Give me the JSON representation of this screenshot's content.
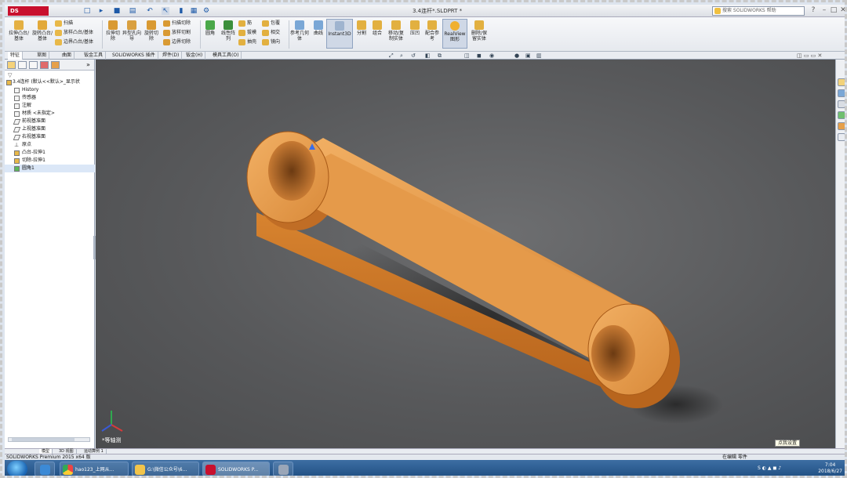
{
  "titlebar": {
    "app_logo": "DS SOLIDWORKS",
    "document_title": "3.4连杆*.SLDPRT *",
    "search_placeholder": "搜索 SOLIDWORKS 帮助",
    "window_controls": [
      "minimize",
      "maximize",
      "close"
    ]
  },
  "ribbon": {
    "large_buttons": [
      {
        "id": "extrude-boss",
        "label": "拉伸凸台/基体",
        "icon": "extrude-boss-icon"
      },
      {
        "id": "revolve-boss",
        "label": "旋转凸台/基体",
        "icon": "revolve-boss-icon"
      },
      {
        "id": "extrude-cut",
        "label": "拉伸切除",
        "icon": "extrude-cut-icon"
      },
      {
        "id": "hole-wizard",
        "label": "异型孔向导",
        "icon": "hole-wizard-icon"
      },
      {
        "id": "revolve-cut",
        "label": "旋转切除",
        "icon": "revolve-cut-icon"
      },
      {
        "id": "fillet",
        "label": "圆角",
        "icon": "fillet-icon"
      },
      {
        "id": "linear-pattern",
        "label": "线性阵列",
        "icon": "linear-pattern-icon"
      },
      {
        "id": "reference-geometry",
        "label": "参考几何体",
        "icon": "reference-geometry-icon"
      },
      {
        "id": "curves",
        "label": "曲线",
        "icon": "curves-icon"
      },
      {
        "id": "instant3d",
        "label": "Instant3D",
        "icon": "instant3d-icon"
      },
      {
        "id": "split",
        "label": "分割",
        "icon": "split-icon"
      },
      {
        "id": "combine",
        "label": "组合",
        "icon": "combine-icon"
      },
      {
        "id": "move-copy",
        "label": "移动/复制实体",
        "icon": "move-copy-icon"
      },
      {
        "id": "indent",
        "label": "压凹",
        "icon": "indent-icon"
      },
      {
        "id": "ref-geom2",
        "label": "配合参考",
        "icon": "mate-reference-icon"
      },
      {
        "id": "realview",
        "label": "RealView图形",
        "icon": "realview-icon"
      },
      {
        "id": "delete-body",
        "label": "删除/保留实体",
        "icon": "delete-body-icon"
      }
    ],
    "small_buttons_group1": [
      "扫描",
      "放样凸台/基体",
      "边界凸台/基体"
    ],
    "small_buttons_group2": [
      "扫描切除",
      "放样切割",
      "边界切除"
    ],
    "small_buttons_group3": [
      "筋",
      "拔模",
      "抽壳"
    ],
    "small_buttons_group4": [
      "包覆",
      "相交",
      "镜向"
    ]
  },
  "command_tabs": [
    "特征",
    "草图",
    "曲面",
    "钣金工具",
    "SOLIDWORKS 插件",
    "焊件(D)",
    "钣金(H)",
    "模具工具(O)"
  ],
  "feature_tree": {
    "filter_icon": "filter-icon",
    "root": "3.4连杆 (默认<<默认>_显示状",
    "items": [
      {
        "label": "History",
        "icon": "history-icon"
      },
      {
        "label": "传感器",
        "icon": "sensor-icon"
      },
      {
        "label": "注解",
        "icon": "annotation-icon"
      },
      {
        "label": "材质 <未指定>",
        "icon": "material-icon"
      },
      {
        "label": "前视基准面",
        "icon": "plane-icon"
      },
      {
        "label": "上视基准面",
        "icon": "plane-icon"
      },
      {
        "label": "右视基准面",
        "icon": "plane-icon"
      },
      {
        "label": "原点",
        "icon": "origin-icon"
      },
      {
        "label": "凸台-拉伸1",
        "icon": "extrude-feature-icon"
      },
      {
        "label": "切除-拉伸1",
        "icon": "cut-feature-icon"
      },
      {
        "label": "圆角1",
        "icon": "fillet-feature-icon"
      }
    ]
  },
  "viewport": {
    "triad_label": "*等轴测",
    "part_color": "#d8893a",
    "background": "#5c5d5f"
  },
  "bottom_tabs": [
    "模型",
    "3D 视图",
    "运动算例 1"
  ],
  "status": {
    "left": "SOLIDWORKS Premium 2015 x64 版",
    "mid": "在编辑 零件",
    "tooltip": "点我设置"
  },
  "taskbar": {
    "items": [
      {
        "label": "",
        "icon": "ie-icon"
      },
      {
        "label": "hao123_上网从...",
        "icon": "chrome-icon"
      },
      {
        "label": "G:\\微信公众号\\6...",
        "icon": "folder-icon"
      },
      {
        "label": "SOLIDWORKS P...",
        "icon": "solidworks-icon"
      },
      {
        "label": "",
        "icon": "app-icon"
      }
    ],
    "clock_time": "7:04",
    "clock_date": "2018/6/27"
  }
}
